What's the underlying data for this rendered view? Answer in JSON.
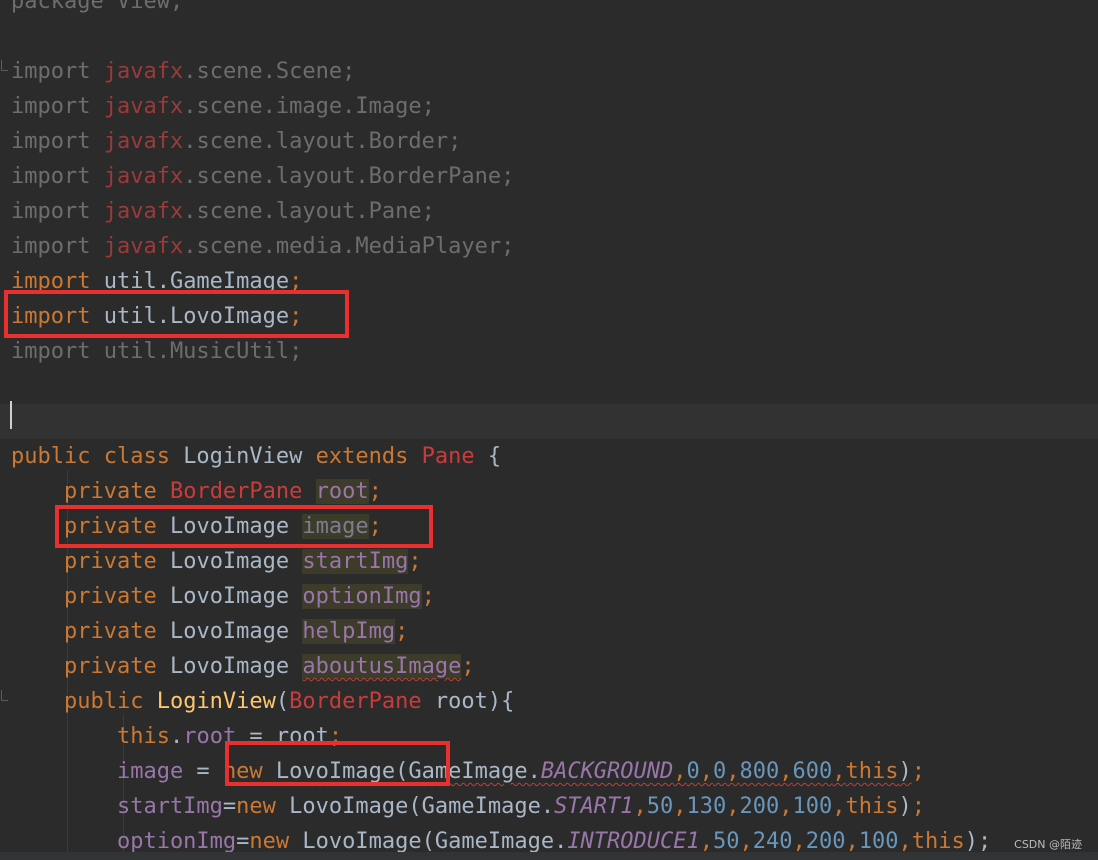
{
  "editor": {
    "lines": [
      [
        [
          "pkg-line",
          "package View;",
          "dim"
        ]
      ],
      [],
      [
        [
          "t",
          "import ",
          "dim"
        ],
        [
          "t",
          "javafx",
          "dimpkg"
        ],
        [
          "t",
          ".scene.Scene;",
          "dim"
        ]
      ],
      [
        [
          "t",
          "import ",
          "dim"
        ],
        [
          "t",
          "javafx",
          "dimpkg"
        ],
        [
          "t",
          ".scene.image.Image;",
          "dim"
        ]
      ],
      [
        [
          "t",
          "import ",
          "dim"
        ],
        [
          "t",
          "javafx",
          "dimpkg"
        ],
        [
          "t",
          ".scene.layout.Border;",
          "dim"
        ]
      ],
      [
        [
          "t",
          "import ",
          "dim"
        ],
        [
          "t",
          "javafx",
          "dimpkg"
        ],
        [
          "t",
          ".scene.layout.BorderPane;",
          "dim"
        ]
      ],
      [
        [
          "t",
          "import ",
          "dim"
        ],
        [
          "t",
          "javafx",
          "dimpkg"
        ],
        [
          "t",
          ".scene.layout.Pane;",
          "dim"
        ]
      ],
      [
        [
          "t",
          "import ",
          "dim"
        ],
        [
          "t",
          "javafx",
          "dimpkg"
        ],
        [
          "t",
          ".scene.media.MediaPlayer;",
          "dim"
        ]
      ],
      [
        [
          "t",
          "import ",
          "kw"
        ],
        [
          "t",
          "util.GameImage",
          "cls"
        ],
        [
          "t",
          ";",
          "kw"
        ]
      ],
      [
        [
          "t",
          "import ",
          "kw"
        ],
        [
          "t",
          "util.LovoImage",
          "cls"
        ],
        [
          "t",
          ";",
          "kw"
        ]
      ],
      [
        [
          "t",
          "import util.MusicUtil;",
          "dim"
        ]
      ],
      [],
      [],
      [
        [
          "t",
          "public class ",
          "kw"
        ],
        [
          "t",
          "LoginView ",
          "cls"
        ],
        [
          "t",
          "extends ",
          "kw"
        ],
        [
          "t",
          "Pane ",
          "typ"
        ],
        [
          "t",
          "{",
          "cls"
        ]
      ],
      [
        [
          "t",
          "    private ",
          "kw"
        ],
        [
          "t",
          "BorderPane ",
          "typ"
        ],
        [
          "t",
          "root",
          "fldhl"
        ],
        [
          "t",
          ";",
          "kw"
        ]
      ],
      [
        [
          "t",
          "    private ",
          "kw"
        ],
        [
          "t",
          "LovoImage ",
          "cls"
        ],
        [
          "t",
          "image",
          "fldhl unused"
        ],
        [
          "t",
          ";",
          "kw"
        ]
      ],
      [
        [
          "t",
          "    private ",
          "kw"
        ],
        [
          "t",
          "LovoImage ",
          "cls"
        ],
        [
          "t",
          "startImg",
          "fldhl"
        ],
        [
          "t",
          ";",
          "kw"
        ]
      ],
      [
        [
          "t",
          "    private ",
          "kw"
        ],
        [
          "t",
          "LovoImage ",
          "cls"
        ],
        [
          "t",
          "optionImg",
          "fldhl"
        ],
        [
          "t",
          ";",
          "kw"
        ]
      ],
      [
        [
          "t",
          "    private ",
          "kw"
        ],
        [
          "t",
          "LovoImage ",
          "cls"
        ],
        [
          "t",
          "helpImg",
          "fldhl"
        ],
        [
          "t",
          ";",
          "kw"
        ]
      ],
      [
        [
          "t",
          "    private ",
          "kw"
        ],
        [
          "t",
          "LovoImage ",
          "cls"
        ],
        [
          "t",
          "aboutusImage",
          "fldhl squig"
        ],
        [
          "t",
          ";",
          "kw"
        ]
      ],
      [
        [
          "t",
          "    public ",
          "kw"
        ],
        [
          "t",
          "LoginView",
          "mth"
        ],
        [
          "t",
          "(",
          "cls"
        ],
        [
          "t",
          "BorderPane ",
          "typ"
        ],
        [
          "t",
          "root){",
          "cls"
        ]
      ],
      [
        [
          "t",
          "        this",
          "kw"
        ],
        [
          "t",
          ".",
          "cls"
        ],
        [
          "t",
          "root",
          "fld"
        ],
        [
          "t",
          " = root",
          "cls"
        ],
        [
          "t",
          ";",
          "kw"
        ]
      ],
      [
        [
          "t",
          "        image",
          "fld"
        ],
        [
          "t",
          " = ",
          "cls"
        ],
        [
          "t",
          "new ",
          "kw"
        ],
        [
          "t",
          "LovoImage(GameImage.",
          "cls squig"
        ],
        [
          "t",
          "BACKGROUND",
          "const squig"
        ],
        [
          "t",
          ",",
          "kw squig"
        ],
        [
          "t",
          "0",
          "num squig"
        ],
        [
          "t",
          ",",
          "kw squig"
        ],
        [
          "t",
          "0",
          "num squig"
        ],
        [
          "t",
          ",",
          "kw squig"
        ],
        [
          "t",
          "800",
          "num squig"
        ],
        [
          "t",
          ",",
          "kw squig"
        ],
        [
          "t",
          "600",
          "num squig"
        ],
        [
          "t",
          ",",
          "kw squig"
        ],
        [
          "t",
          "this",
          "kw squig"
        ],
        [
          "t",
          ")",
          "cls squig"
        ],
        [
          "t",
          ";",
          "kw"
        ]
      ],
      [
        [
          "t",
          "        startImg",
          "fld"
        ],
        [
          "t",
          "=",
          "cls"
        ],
        [
          "t",
          "new ",
          "kw"
        ],
        [
          "t",
          "LovoImage(GameImage.",
          "cls"
        ],
        [
          "t",
          "START1",
          "const"
        ],
        [
          "t",
          ",",
          "kw"
        ],
        [
          "t",
          "50",
          "num"
        ],
        [
          "t",
          ",",
          "kw"
        ],
        [
          "t",
          "130",
          "num"
        ],
        [
          "t",
          ",",
          "kw"
        ],
        [
          "t",
          "200",
          "num"
        ],
        [
          "t",
          ",",
          "kw"
        ],
        [
          "t",
          "100",
          "num"
        ],
        [
          "t",
          ",",
          "kw"
        ],
        [
          "t",
          "this",
          "kw"
        ],
        [
          "t",
          ")",
          "cls"
        ],
        [
          "t",
          ";",
          "kw"
        ]
      ],
      [
        [
          "t",
          "        optionImg",
          "fld"
        ],
        [
          "t",
          "=",
          "cls"
        ],
        [
          "t",
          "new ",
          "kw"
        ],
        [
          "t",
          "LovoImage(GameImage.",
          "cls"
        ],
        [
          "t",
          "INTRODUCE1",
          "const"
        ],
        [
          "t",
          ",",
          "kw"
        ],
        [
          "t",
          "50",
          "num"
        ],
        [
          "t",
          ",",
          "kw"
        ],
        [
          "t",
          "240",
          "num"
        ],
        [
          "t",
          ",",
          "kw"
        ],
        [
          "t",
          "200",
          "num"
        ],
        [
          "t",
          ",",
          "kw"
        ],
        [
          "t",
          "100",
          "num"
        ],
        [
          "t",
          ",",
          "kw"
        ],
        [
          "t",
          "this",
          "kw"
        ],
        [
          "t",
          ");",
          "cls"
        ]
      ]
    ]
  },
  "watermark": "CSDN @陌迹"
}
